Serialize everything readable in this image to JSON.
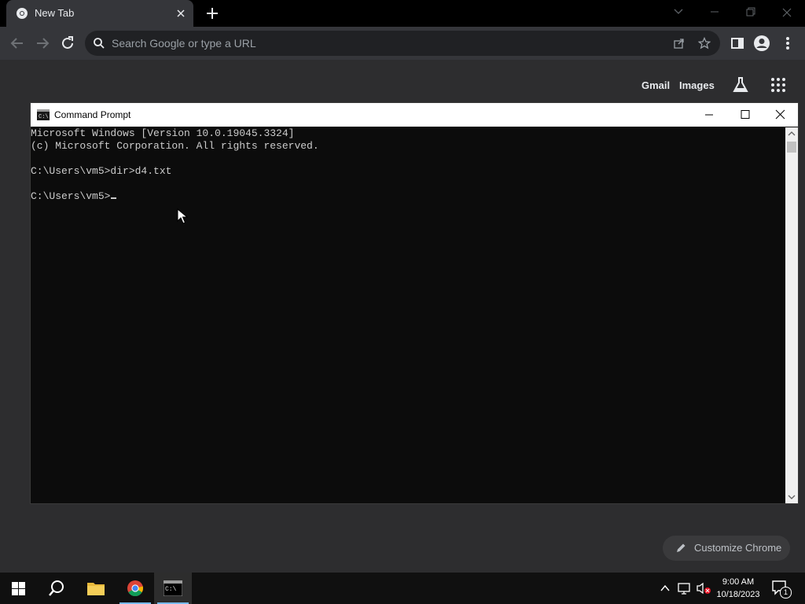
{
  "browser": {
    "tab_title": "New Tab",
    "omnibox_placeholder": "Search Google or type a URL",
    "ntp_links": {
      "gmail": "Gmail",
      "images": "Images"
    },
    "customize_label": "Customize Chrome"
  },
  "cmd": {
    "title": "Command Prompt",
    "lines": [
      "Microsoft Windows [Version 10.0.19045.3324]",
      "(c) Microsoft Corporation. All rights reserved.",
      "",
      "C:\\Users\\vm5>dir>d4.txt",
      "",
      "C:\\Users\\vm5>"
    ]
  },
  "taskbar": {
    "time": "9:00 AM",
    "date": "10/18/2023",
    "notification_count": "1"
  },
  "icons": [
    "chrome-favicon-icon",
    "close-icon",
    "plus-icon",
    "chevron-down-icon",
    "minimize-icon",
    "restore-icon",
    "back-arrow-icon",
    "forward-arrow-icon",
    "reload-icon",
    "search-icon",
    "share-icon",
    "star-icon",
    "side-panel-icon",
    "profile-icon",
    "more-vert-icon",
    "labs-flask-icon",
    "apps-grid-icon",
    "pencil-icon",
    "cmd-icon",
    "maximize-icon",
    "windows-start-icon",
    "taskbar-search-icon",
    "file-explorer-icon",
    "chrome-icon",
    "chevron-up-icon",
    "network-icon",
    "volume-muted-icon",
    "action-center-icon"
  ]
}
